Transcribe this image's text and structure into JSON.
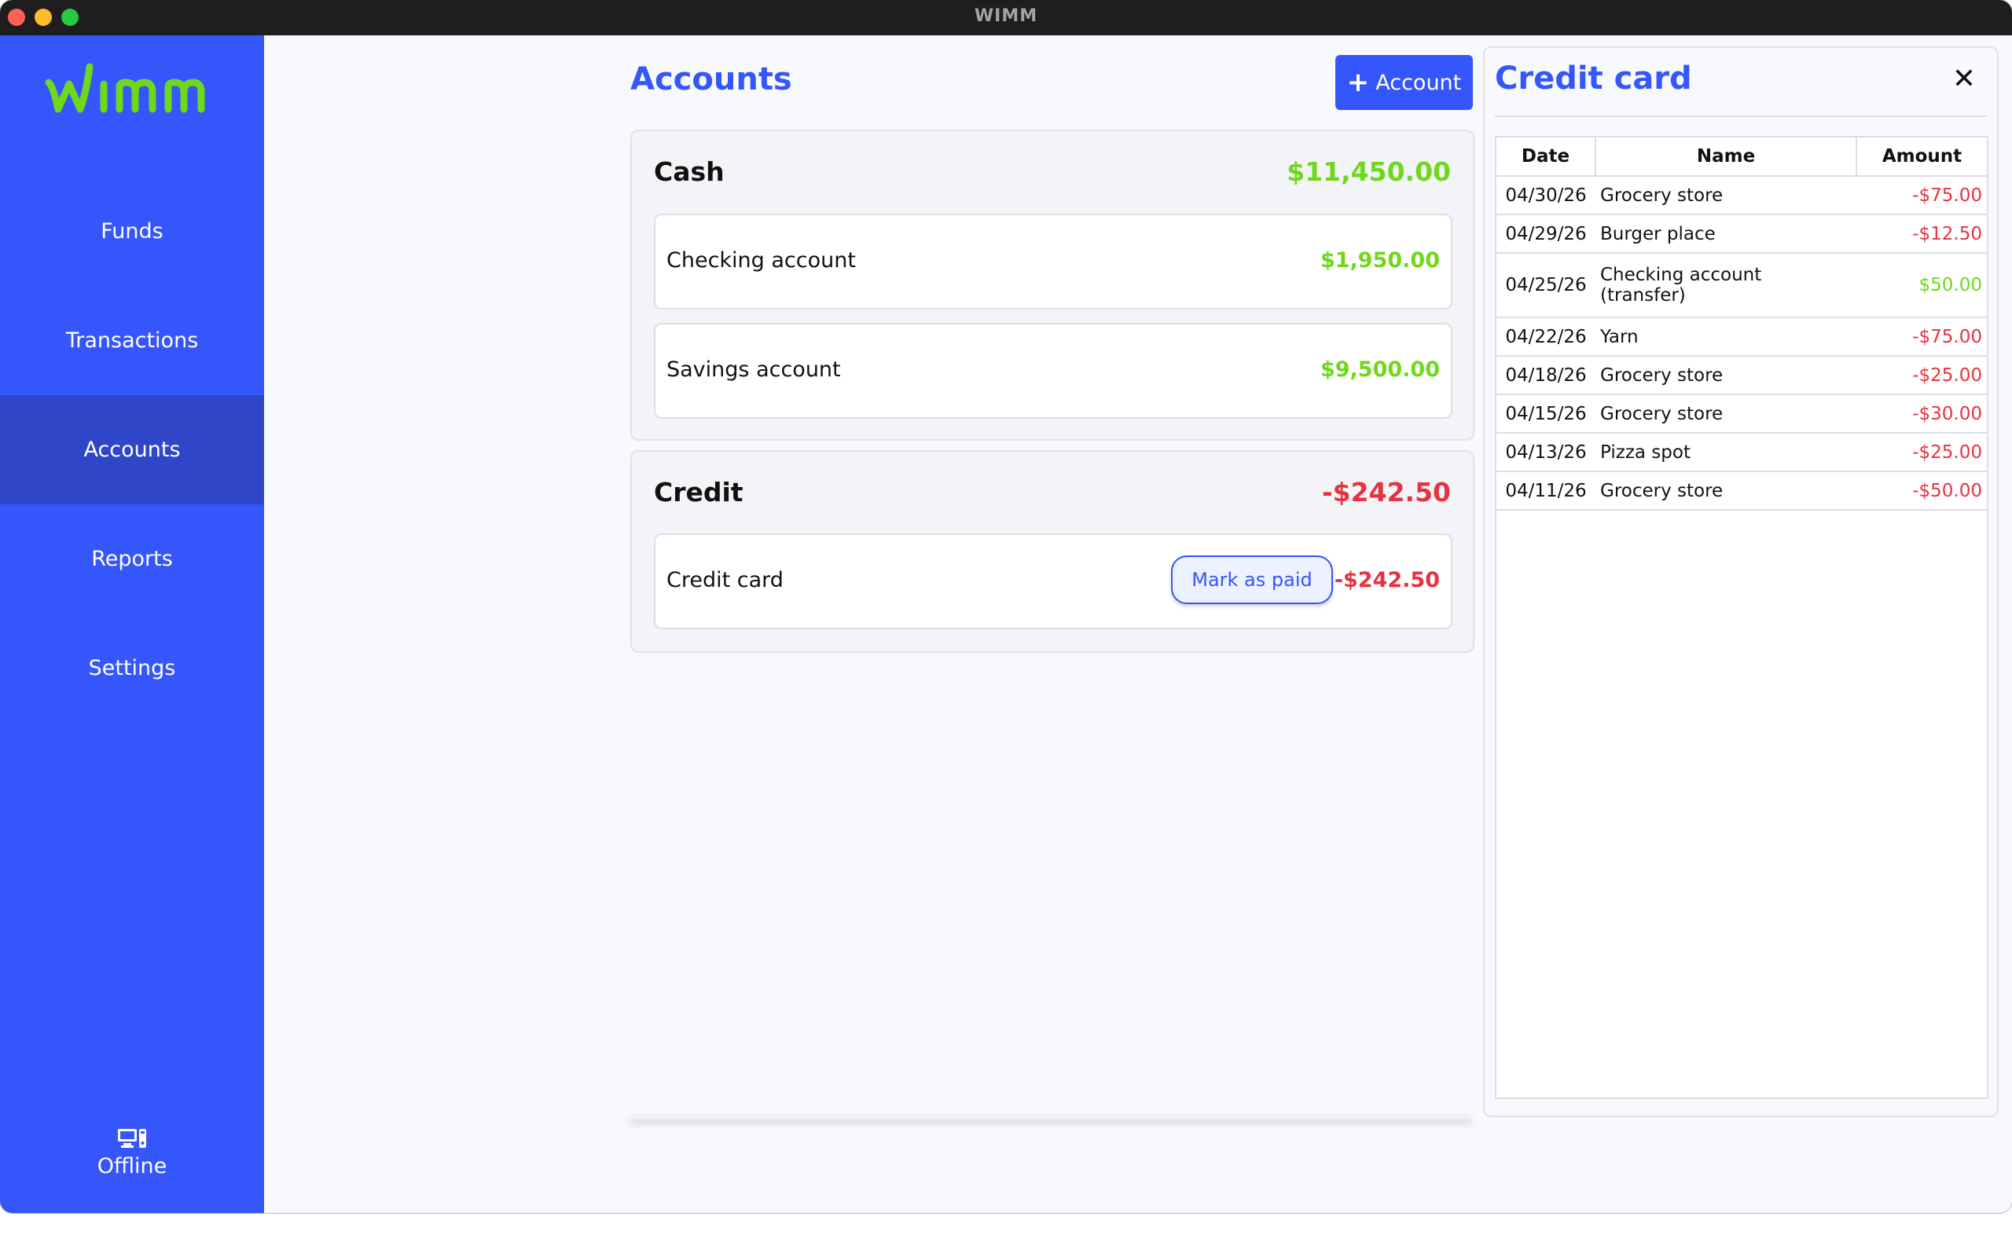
{
  "window": {
    "title": "WIMM"
  },
  "sidebar": {
    "logo": "wimm",
    "items": [
      {
        "label": "Funds",
        "active": false
      },
      {
        "label": "Transactions",
        "active": false
      },
      {
        "label": "Accounts",
        "active": true
      },
      {
        "label": "Reports",
        "active": false
      },
      {
        "label": "Settings",
        "active": false
      }
    ],
    "status": {
      "icon": "devices-icon",
      "label": "Offline"
    }
  },
  "main": {
    "title": "Accounts",
    "add_button": {
      "icon": "plus-icon",
      "label": "Account"
    },
    "groups": [
      {
        "name": "Cash",
        "total": "$11,450.00",
        "accounts": [
          {
            "name": "Checking account",
            "balance": "$1,950.00"
          },
          {
            "name": "Savings account",
            "balance": "$9,500.00"
          }
        ]
      },
      {
        "name": "Credit",
        "total": "-$242.50",
        "accounts": [
          {
            "name": "Credit card",
            "balance": "-$242.50",
            "action": "Mark as paid"
          }
        ]
      }
    ]
  },
  "detail": {
    "title": "Credit card",
    "close_icon": "close-icon",
    "columns": [
      "Date",
      "Name",
      "Amount"
    ],
    "rows": [
      {
        "date": "04/30/26",
        "name": "Grocery store",
        "amount": "-$75.00"
      },
      {
        "date": "04/29/26",
        "name": "Burger place",
        "amount": "-$12.50"
      },
      {
        "date": "04/25/26",
        "name": "Checking account (transfer)",
        "amount": "$50.00"
      },
      {
        "date": "04/22/26",
        "name": "Yarn",
        "amount": "-$75.00"
      },
      {
        "date": "04/18/26",
        "name": "Grocery store",
        "amount": "-$25.00"
      },
      {
        "date": "04/15/26",
        "name": "Grocery store",
        "amount": "-$30.00"
      },
      {
        "date": "04/13/26",
        "name": "Pizza spot",
        "amount": "-$25.00"
      },
      {
        "date": "04/11/26",
        "name": "Grocery store",
        "amount": "-$50.00"
      }
    ]
  },
  "colors": {
    "brand": "#3456fb",
    "sidebar_active": "#2f46c9",
    "logo": "#6fd81b",
    "positive": "#6fd81b",
    "negative": "#e53340"
  }
}
